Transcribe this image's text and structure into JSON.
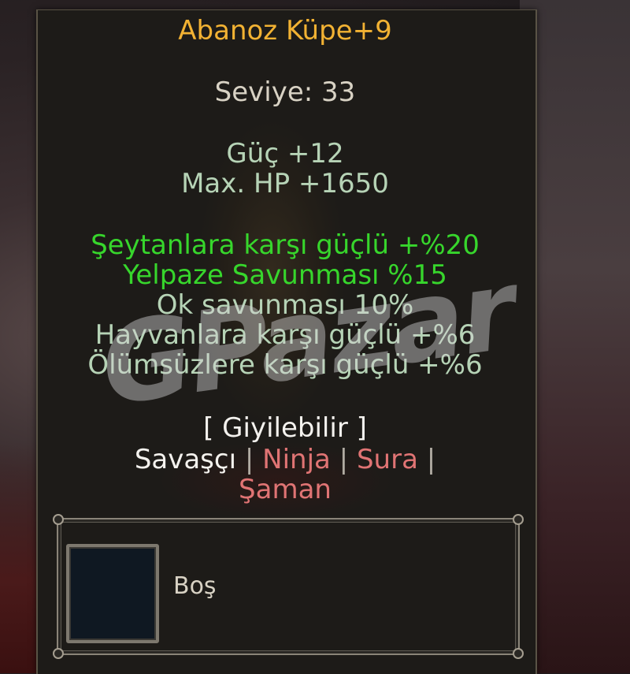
{
  "item": {
    "name": "Abanoz Küpe+9",
    "level": "Seviye: 33",
    "stats": [
      "Güç +12",
      "Max. HP +1650"
    ],
    "bonuses": [
      "Şeytanlara karşı güçlü +%20",
      "Yelpaze Savunması %15",
      "Ok savunması 10%",
      "Hayvanlara karşı güçlü +%6",
      "Ölümsüzlere karşı güçlü +%6"
    ],
    "wearable": "[ Giyilebilir ]",
    "classes": {
      "warrior": "Savaşçı",
      "ninja": "Ninja",
      "sura": "Sura",
      "shaman": "Şaman",
      "separator": "|"
    }
  },
  "socket": {
    "label": "Boş"
  },
  "watermark": "GPazar",
  "colors": {
    "name": "#f2b233",
    "bonus_green": "#37d62c",
    "bonus_pale": "#b6d3b6",
    "restricted_class": "#e07474",
    "allowed_class": "#f4f2ee"
  }
}
